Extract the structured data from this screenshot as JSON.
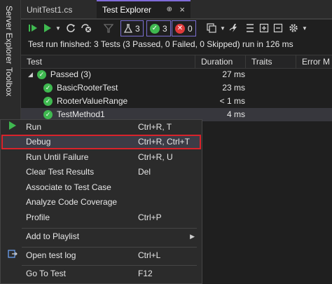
{
  "side_rail": {
    "server_explorer": "Server Explorer",
    "toolbox": "Toolbox"
  },
  "tabs": {
    "file_tab": "UnitTest1.cs",
    "active_tab": "Test Explorer",
    "pin_glyph": "⊕",
    "close_glyph": "×"
  },
  "toolbar": {
    "flask_count": "3",
    "passed_count": "3",
    "failed_count": "0"
  },
  "status": "Test run finished: 3 Tests (3 Passed, 0 Failed, 0 Skipped) run in 126 ms",
  "columns": {
    "test": "Test",
    "duration": "Duration",
    "traits": "Traits",
    "error": "Error M"
  },
  "rows": [
    {
      "name": "Passed  (3)",
      "duration": "27 ms"
    },
    {
      "name": "BasicRooterTest",
      "duration": "23 ms"
    },
    {
      "name": "RooterValueRange",
      "duration": "< 1 ms"
    },
    {
      "name": "TestMethod1",
      "duration": "4 ms"
    }
  ],
  "menu": [
    {
      "label": "Run",
      "shortcut": "Ctrl+R, T"
    },
    {
      "label": "Debug",
      "shortcut": "Ctrl+R, Ctrl+T"
    },
    {
      "label": "Run Until Failure",
      "shortcut": "Ctrl+R, U"
    },
    {
      "label": "Clear Test Results",
      "shortcut": "Del"
    },
    {
      "label": "Associate to Test Case",
      "shortcut": ""
    },
    {
      "label": "Analyze Code Coverage",
      "shortcut": ""
    },
    {
      "label": "Profile",
      "shortcut": "Ctrl+P"
    },
    {
      "label": "Add to Playlist",
      "shortcut": ""
    },
    {
      "label": "Open test log",
      "shortcut": "Ctrl+L"
    },
    {
      "label": "Go To Test",
      "shortcut": "F12"
    }
  ],
  "colors": {
    "accent": "#7f6bd8",
    "pass": "#3fb950",
    "fail": "#e03a3a",
    "highlight_border": "#d9232b"
  }
}
